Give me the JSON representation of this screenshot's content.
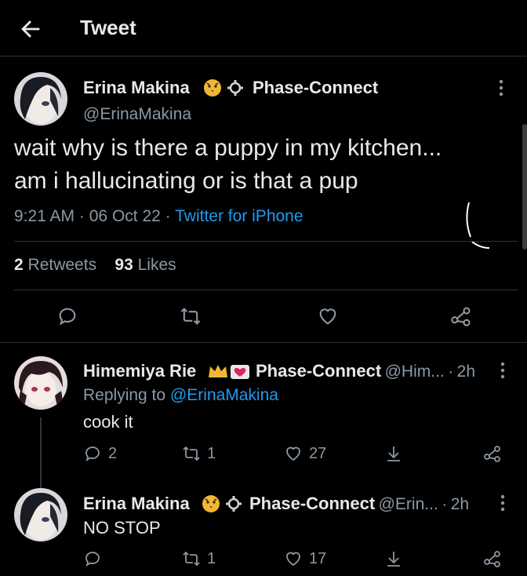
{
  "header": {
    "title": "Tweet"
  },
  "main_tweet": {
    "name": "Erina Makina",
    "badge_text": "Phase-Connect",
    "handle": "@ErinaMakina",
    "text_line1": "wait why is there a puppy in my kitchen...",
    "text_line2": "am i hallucinating or is that a pup",
    "time": "9:21 AM",
    "date": "06 Oct 22",
    "source": "Twitter for iPhone",
    "retweets_count": "2",
    "retweets_label": "Retweets",
    "likes_count": "93",
    "likes_label": "Likes"
  },
  "replies": [
    {
      "name": "Himemiya Rie",
      "badge_text": "Phase-Connect",
      "handle": "@Him...",
      "time": "2h",
      "replying_label": "Replying to",
      "replying_to": "@ErinaMakina",
      "text": "cook it",
      "reply_count": "2",
      "retweet_count": "1",
      "like_count": "27"
    },
    {
      "name": "Erina Makina",
      "badge_text": "Phase-Connect",
      "handle": "@Erin...",
      "time": "2h",
      "text": "NO STOP",
      "retweet_count": "1",
      "like_count": "17"
    }
  ],
  "separator": "·",
  "icons": {
    "back": "back-arrow-icon",
    "reply": "reply-icon",
    "retweet": "retweet-icon",
    "like": "heart-icon",
    "share": "share-icon",
    "download": "download-arrow-icon",
    "more": "more-vertical-icon"
  }
}
